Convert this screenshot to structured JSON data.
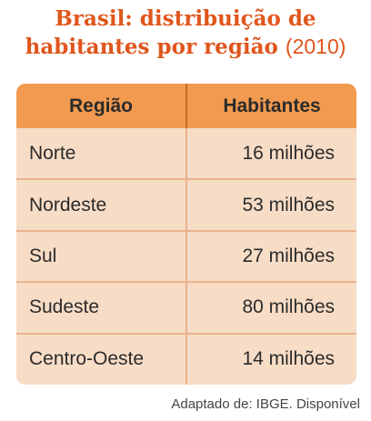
{
  "title": {
    "line1": "Brasil: distribuição de",
    "line2": "habitantes por região",
    "year": "(2010)"
  },
  "table": {
    "headers": [
      "Região",
      "Habitantes"
    ],
    "rows": [
      {
        "region": "Norte",
        "population": "16 milhões"
      },
      {
        "region": "Nordeste",
        "population": "53 milhões"
      },
      {
        "region": "Sul",
        "population": "27 milhões"
      },
      {
        "region": "Sudeste",
        "population": "80 milhões"
      },
      {
        "region": "Centro-Oeste",
        "population": "14 milhões"
      }
    ]
  },
  "source": "Adaptado de: IBGE. Disponível",
  "colors": {
    "title": "#e0561c",
    "header_bg": "#f29a4f",
    "body_bg": "#f7dcc6"
  }
}
